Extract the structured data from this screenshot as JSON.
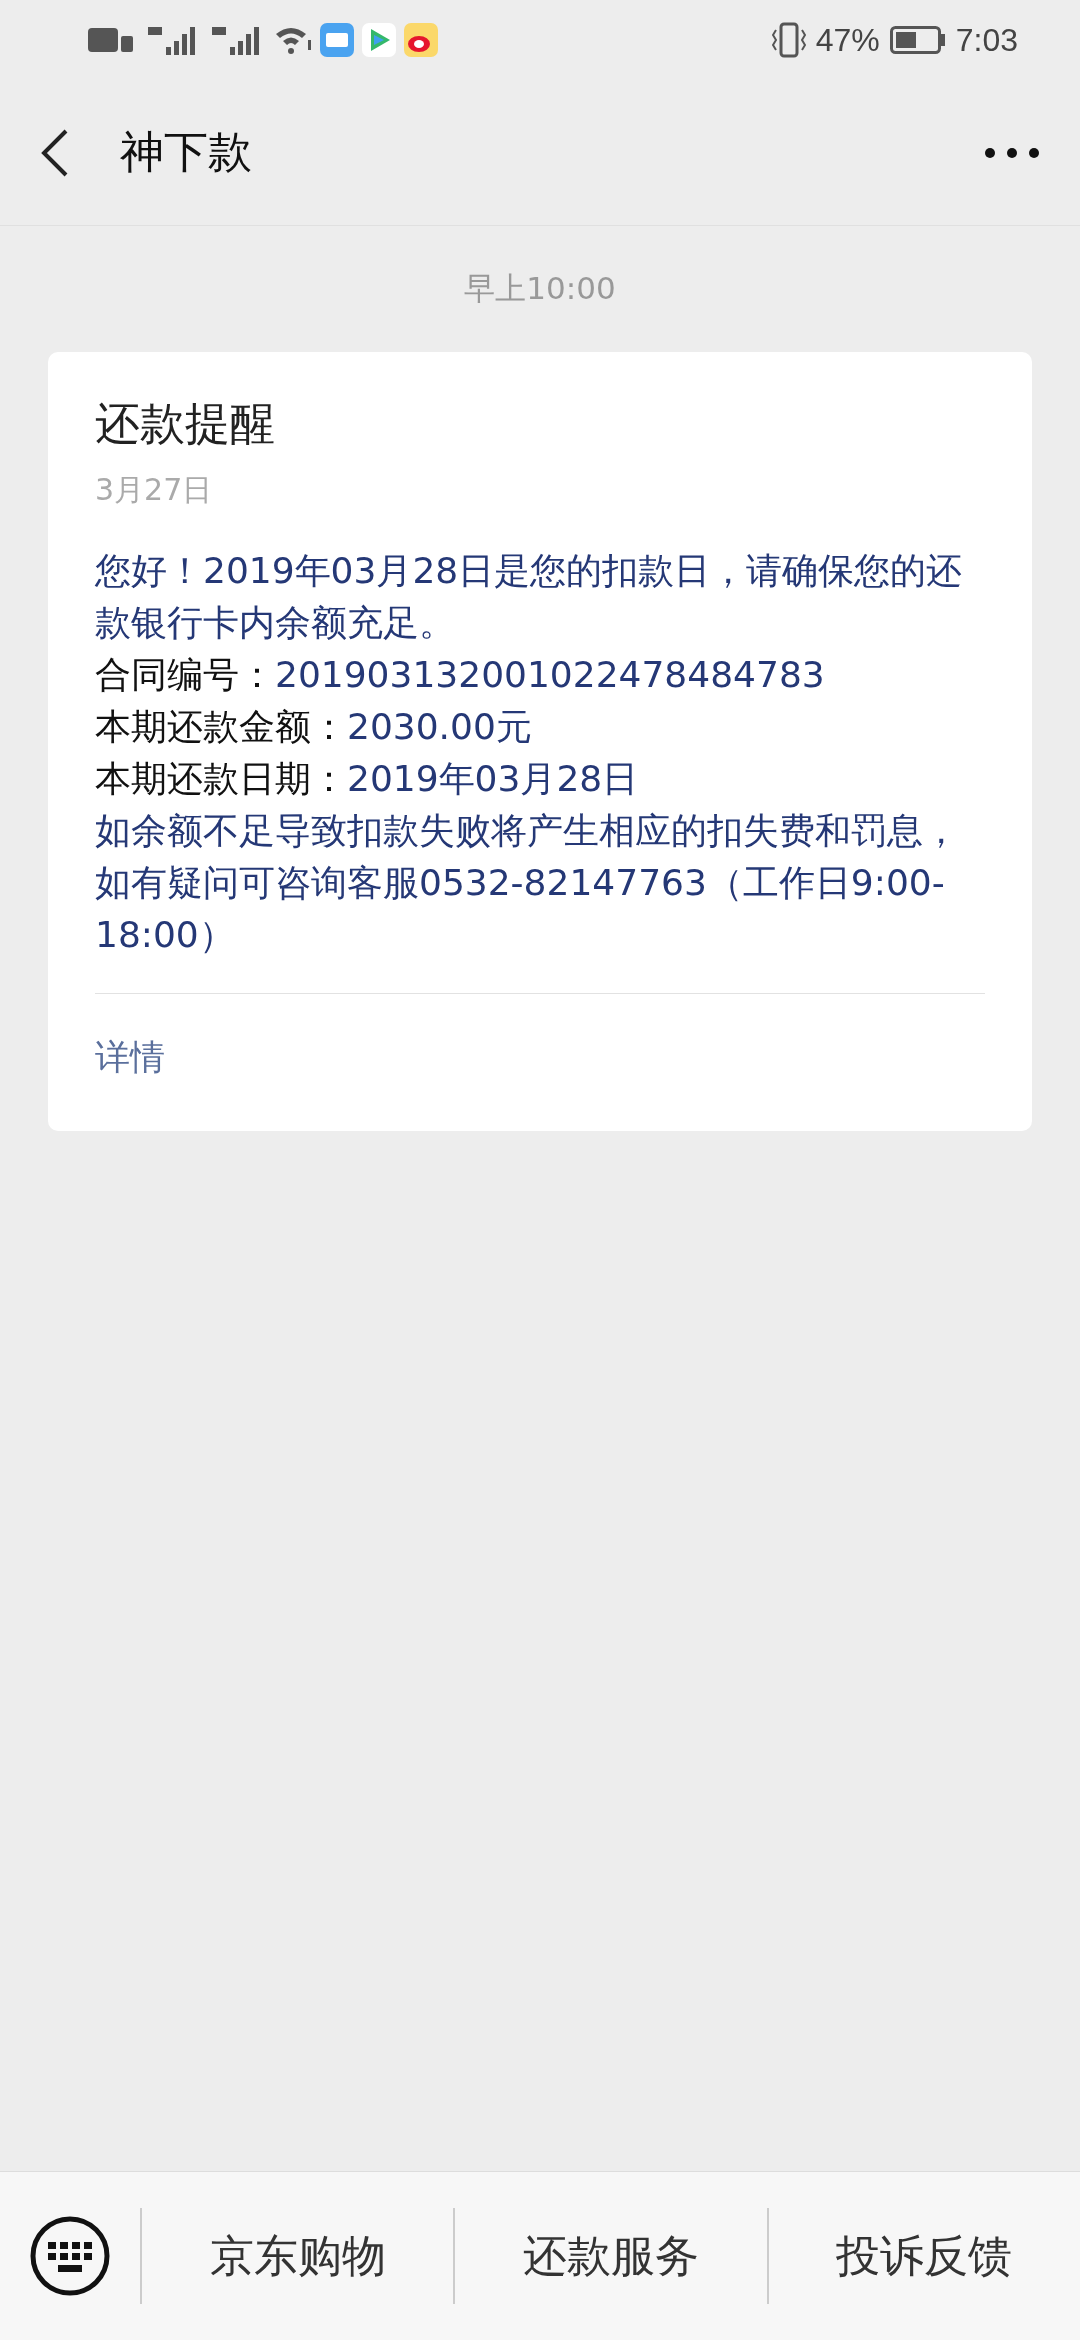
{
  "status_bar": {
    "battery_percent": "47%",
    "time": "7:03"
  },
  "header": {
    "title": "神下款"
  },
  "timestamp": "早上10:00",
  "card": {
    "title": "还款提醒",
    "date": "3月27日",
    "intro": "您好！2019年03月28日是您的扣款日，请确保您的还款银行卡内余额充足。",
    "fields": [
      {
        "label": "合同编号：",
        "value": "201903132001022478484783"
      },
      {
        "label": "本期还款金额：",
        "value": "2030.00元"
      },
      {
        "label": "本期还款日期：",
        "value": "2019年03月28日"
      }
    ],
    "notice": "如余额不足导致扣款失败将产生相应的扣失费和罚息，如有疑问可咨询客服0532-82147763（工作日9:00-18:00）",
    "link": "详情"
  },
  "menu": [
    "京东购物",
    "还款服务",
    "投诉反馈"
  ]
}
